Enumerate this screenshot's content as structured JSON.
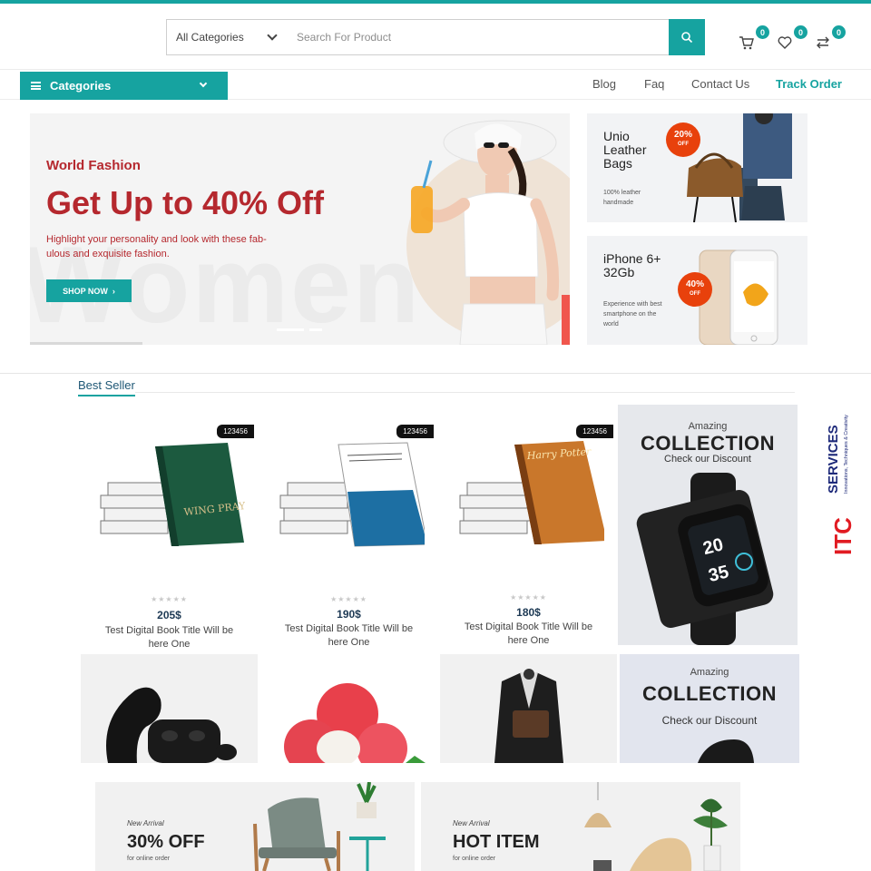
{
  "colors": {
    "accent": "#16a3a0",
    "sale_red": "#b5282e",
    "discount_orange": "#e8410c",
    "price_navy": "#1e3a55"
  },
  "header": {
    "category_select": "All Categories",
    "search_placeholder": "Search For Product",
    "cart_count": "0",
    "wishlist_count": "0",
    "compare_count": "0"
  },
  "nav": {
    "categories_label": "Categories",
    "links": [
      "Blog",
      "Faq",
      "Contact Us",
      "Track Order"
    ]
  },
  "hero": {
    "subtitle": "World Fashion",
    "title": "Get Up to 40% Off",
    "description": "Highlight your personality and look with these fab-ulous and exquisite fashion.",
    "button": "SHOP NOW",
    "watermark": "Women"
  },
  "promos": [
    {
      "title": "Unio Leather Bags",
      "note": "100% leather handmade",
      "discount": "20%",
      "discount_suffix": "OFF"
    },
    {
      "title": "iPhone 6+ 32Gb",
      "note": "Experience with best smartphone on the world",
      "discount": "40%",
      "discount_suffix": "OFF"
    }
  ],
  "best_seller": {
    "tab": "Best Seller",
    "products": [
      {
        "tag": "123456",
        "rating": "★★★★★",
        "price": "205$",
        "name": "Test Digital Book Title Will be here One",
        "cover_title": "WING PRAYER"
      },
      {
        "tag": "123456",
        "rating": "★★★★★",
        "price": "190$",
        "name": "Test Digital Book Title Will be here One",
        "cover_title": ""
      },
      {
        "tag": "123456",
        "rating": "★★★★★",
        "price": "180$",
        "name": "Test Digital Book Title Will be here One",
        "cover_title": "Harry Potter"
      }
    ]
  },
  "ads": [
    {
      "amazing": "Amazing",
      "collection": "COLLECTION",
      "check": "Check our Discount",
      "watch_time": "20",
      "watch_min": "35"
    },
    {
      "amazing": "Amazing",
      "collection": "COLLECTION",
      "check": "Check our Discount"
    }
  ],
  "bottom_banners": [
    {
      "kicker": "New Arrival",
      "headline": "30% OFF",
      "sub": "for online order"
    },
    {
      "kicker": "New Arrival",
      "headline": "HOT ITEM",
      "sub": "for online order"
    }
  ],
  "logo": {
    "mark": "ITC",
    "name": "SERVICES",
    "tagline": "Innovations, Techniques & Creativity"
  }
}
